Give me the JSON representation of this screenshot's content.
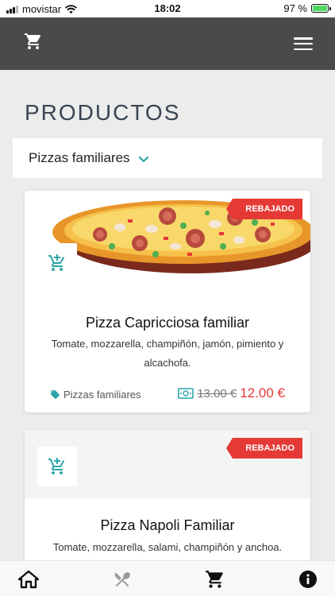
{
  "status_bar": {
    "carrier": "movistar",
    "time": "18:02",
    "battery": "97 %"
  },
  "header": {
    "cart_icon": "cart-icon",
    "menu_icon": "hamburger-icon"
  },
  "page": {
    "title": "PRODUCTOS"
  },
  "category_filter": {
    "selected": "Pizzas familiares"
  },
  "products": [
    {
      "badge": "REBAJADO",
      "name": "Pizza Capricciosa familiar",
      "description": "Tomate, mozzarella, champiñón, jamón, pimiento y alcachofa.",
      "category": "Pizzas familiares",
      "old_price": "13.00 €",
      "price": "12.00 €"
    },
    {
      "badge": "REBAJADO",
      "name": "Pizza Napoli Familiar",
      "description": "Tomate, mozzarella, salami, champiñón y anchoa."
    }
  ],
  "colors": {
    "header": "#4a4a4a",
    "accent": "#2aa6a8",
    "badge": "#e53935",
    "price": "#e53935",
    "title": "#3a4452"
  }
}
